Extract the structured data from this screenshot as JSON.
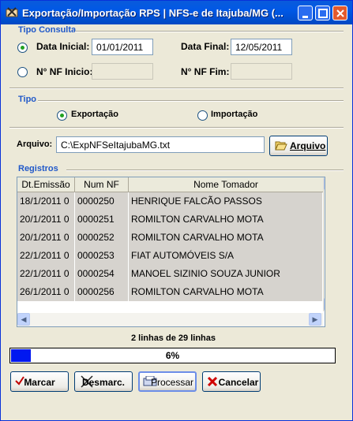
{
  "window": {
    "title": "Exportação/Importação RPS  |  NFS-e de Itajuba/MG (...",
    "colors": {
      "titlebar": "#0058e6",
      "section": "#2159c9",
      "progress_fill": "#0018f0"
    }
  },
  "tipo_consulta": {
    "section_label": "Tipo Consulta",
    "data_inicial_label": "Data Inicial:",
    "data_inicial_value": "01/01/2011",
    "data_final_label": "Data Final:",
    "data_final_value": "12/05/2011",
    "nf_inicio_label": "N° NF Inicio:",
    "nf_inicio_value": "",
    "nf_fim_label": "N° NF Fim:",
    "nf_fim_value": "",
    "selected": "data"
  },
  "tipo": {
    "section_label": "Tipo",
    "exportacao_label": "Exportação",
    "importacao_label": "Importação",
    "selected": "exportacao"
  },
  "arquivo": {
    "label": "Arquivo:",
    "value": "C:\\ExpNFSeItajubaMG.txt",
    "button_label": "Arquivo",
    "button_icon": "folder-open-icon"
  },
  "registros": {
    "section_label": "Registros",
    "columns": [
      "Dt.Emissão",
      "Num NF",
      "Nome Tomador"
    ],
    "rows": [
      [
        "18/1/2011 0",
        "0000250",
        "HENRIQUE FALCÃO PASSOS"
      ],
      [
        "20/1/2011 0",
        "0000251",
        "ROMILTON CARVALHO MOTA"
      ],
      [
        "20/1/2011 0",
        "0000252",
        "ROMILTON CARVALHO MOTA"
      ],
      [
        "22/1/2011 0",
        "0000253",
        "FIAT AUTOMÓVEIS S/A"
      ],
      [
        "22/1/2011 0",
        "0000254",
        "MANOEL SIZINIO SOUZA JUNIOR"
      ],
      [
        "26/1/2011 0",
        "0000256",
        "ROMILTON CARVALHO MOTA"
      ]
    ]
  },
  "status": {
    "lines_text": "2 linhas de 29 linhas",
    "progress_text": "6%",
    "progress_fraction": 0.06
  },
  "buttons": {
    "marcar": "Marcar",
    "desmarcar": "Desmarc.",
    "processar": "Processar",
    "cancelar": "Cancelar"
  }
}
